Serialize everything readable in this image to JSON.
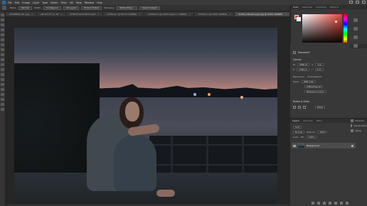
{
  "menu": {
    "items": [
      "File",
      "Edit",
      "Image",
      "Layer",
      "Type",
      "Select",
      "Filter",
      "3D",
      "View",
      "Window",
      "Help"
    ]
  },
  "options_bar": {
    "labels": [
      "Mode:",
      "Normal",
      "Width:",
      "Contiguous",
      "All Layers",
      "Protect Detail",
      "Tolerance:"
    ],
    "buttons": [
      "Refine Edge...",
      "Select Subject"
    ]
  },
  "tabs": [
    {
      "label": "25436860_4K...jpg",
      "active": false
    },
    {
      "label": "AR-101-TT_4...tif",
      "active": false
    },
    {
      "label": "ST-BX2T14-Portfolio.psd",
      "active": false
    },
    {
      "label": "Untitled-1 @ 66.7% (RGB/8)",
      "active": false
    },
    {
      "label": "Untitled-2 @ 100% (Layer 1, RGB/8)",
      "active": false
    },
    {
      "label": "Untitled-3 @ 100% (RGB/8)",
      "active": false
    },
    {
      "label": "dmitry-ratushny-girl.jpg @ 100% (RGB/8)",
      "active": true
    }
  ],
  "right_panel": {
    "top_tabs": [
      "Color",
      "Swatches",
      "Gradients",
      "Patterns"
    ],
    "colors": {
      "foreground": "#c94a3a",
      "background": "#f0f0f0"
    }
  },
  "properties": {
    "tabs": [
      "Properties",
      "Adjustments"
    ],
    "section_title": "Document",
    "canvas_label": "Canvas",
    "w_label": "W",
    "w_value": "2048 px",
    "h_label": "H",
    "h_value": "1365 px",
    "x_label": "X",
    "x_value": "0 px",
    "y_label": "Y",
    "y_value": "0 px",
    "resolution_label": "Resolution:",
    "resolution_value": "72 pixels/inch",
    "mode_label": "Mode:",
    "mode_value": "RGB Color",
    "bits_value": "8 Bits/Channel",
    "fill_value": "Background Color",
    "rulers_label": "Rulers & Grids",
    "units_value": "Pixels"
  },
  "layers": {
    "tabs": [
      "Layers",
      "Channels",
      "Paths"
    ],
    "kind_label": "Kind",
    "blend_mode": "Normal",
    "opacity_label": "Opacity:",
    "opacity_value": "100%",
    "lock_label": "Lock:",
    "fill_label": "Fill:",
    "fill_value": "100%",
    "items": [
      {
        "name": "Background"
      }
    ]
  },
  "side_panels": [
    "Libraries",
    "Adjustments",
    "Styles"
  ]
}
